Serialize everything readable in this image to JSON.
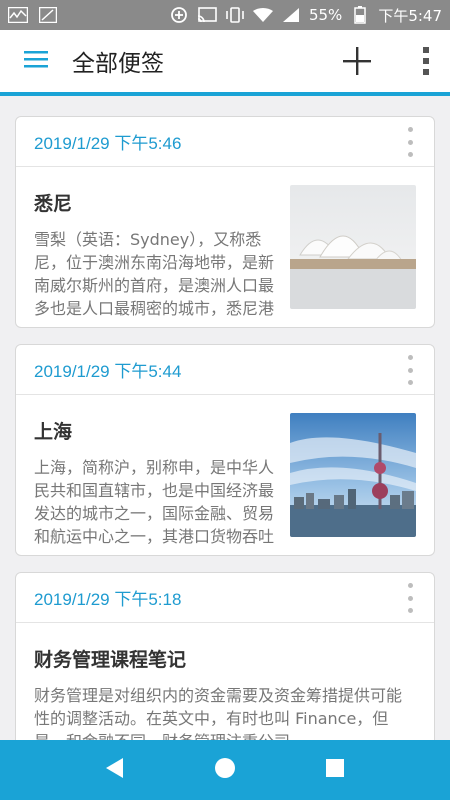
{
  "status_bar": {
    "battery_percent": "55%",
    "time": "下午5:47"
  },
  "app_bar": {
    "title": "全部便签"
  },
  "notes": [
    {
      "date": "2019/1/29 下午5:46",
      "title": "悉尼",
      "text": "雪梨（英语：Sydney），又称悉尼，位于澳洲东南沿海地带，是新南威尔斯州的首府，是澳洲人口最多也是人口最稠密的城市，悉尼港口……"
    },
    {
      "date": "2019/1/29 下午5:44",
      "title": "上海",
      "text": "上海，简称沪，别称申，是中华人民共和国直辖市，也是中国经济最发达的城市之一，国际金融、贸易和航运中心之一，其港口货物吞吐量位居世界……"
    },
    {
      "date": "2019/1/29 下午5:18",
      "title": "财务管理课程笔记",
      "text": "财务管理是对组织内的资金需要及资金筹措提供可能性的调整活动。在英文中，有时也叫 Finance，但是，和金融不同，财务管理注重公司……"
    }
  ]
}
